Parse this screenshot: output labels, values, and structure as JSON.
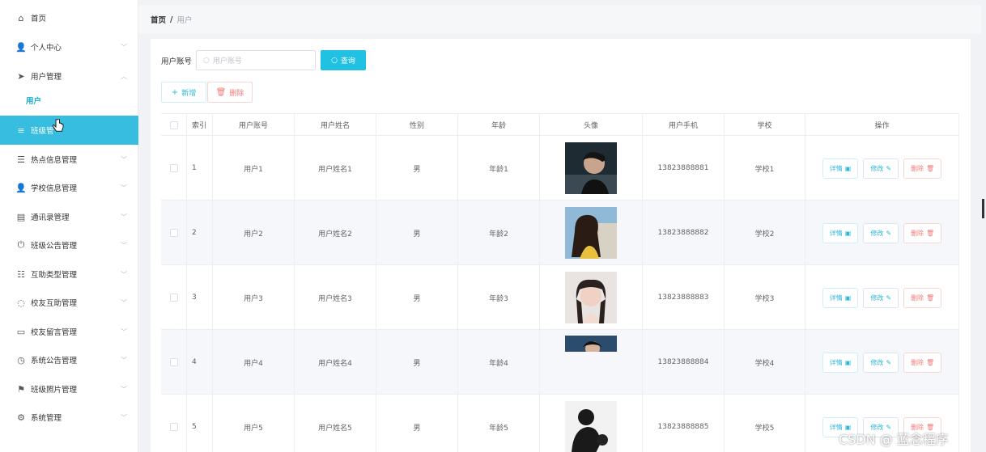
{
  "sidebar": {
    "items": [
      {
        "label": "首页",
        "icon": "home-icon",
        "glyph": "⌂",
        "has_arrow": false
      },
      {
        "label": "个人中心",
        "icon": "person-icon",
        "glyph": "👤",
        "has_arrow": true
      },
      {
        "label": "用户管理",
        "icon": "send-icon",
        "glyph": "➤",
        "has_arrow": true,
        "expanded": true
      },
      {
        "label": "用户",
        "icon": "",
        "glyph": "",
        "has_arrow": false,
        "sub": true
      },
      {
        "label": "班级管",
        "icon": "menu-icon",
        "glyph": "≡",
        "has_arrow": false,
        "active": true
      },
      {
        "label": "热点信息管理",
        "icon": "list-icon",
        "glyph": "☰",
        "has_arrow": true
      },
      {
        "label": "学校信息管理",
        "icon": "user-icon",
        "glyph": "👤",
        "has_arrow": true
      },
      {
        "label": "通讯录管理",
        "icon": "contacts-icon",
        "glyph": "▤",
        "has_arrow": true
      },
      {
        "label": "班级公告管理",
        "icon": "power-icon",
        "glyph": "⏻",
        "has_arrow": true
      },
      {
        "label": "互助类型管理",
        "icon": "category-icon",
        "glyph": "☷",
        "has_arrow": true
      },
      {
        "label": "校友互助管理",
        "icon": "help-icon",
        "glyph": "◌",
        "has_arrow": true
      },
      {
        "label": "校友留言管理",
        "icon": "message-icon",
        "glyph": "▭",
        "has_arrow": true
      },
      {
        "label": "系统公告管理",
        "icon": "compass-icon",
        "glyph": "◷",
        "has_arrow": true
      },
      {
        "label": "班级照片管理",
        "icon": "flag-icon",
        "glyph": "⚑",
        "has_arrow": true
      },
      {
        "label": "系统管理",
        "icon": "settings-icon",
        "glyph": "⚙",
        "has_arrow": true
      }
    ]
  },
  "breadcrumb": {
    "home": "首页",
    "sep": "/",
    "current": "用户"
  },
  "search": {
    "label": "用户账号",
    "placeholder": "用户账号",
    "button": "查询"
  },
  "actions": {
    "add": "新增",
    "delete": "删除"
  },
  "table": {
    "headers": [
      "索引",
      "用户账号",
      "用户姓名",
      "性别",
      "年龄",
      "头像",
      "用户手机",
      "学校",
      "操作"
    ],
    "rows": [
      {
        "index": "1",
        "account": "用户1",
        "name": "用户姓名1",
        "gender": "男",
        "age": "年龄1",
        "phone": "13823888881",
        "school": "学校1"
      },
      {
        "index": "2",
        "account": "用户2",
        "name": "用户姓名2",
        "gender": "男",
        "age": "年龄2",
        "phone": "13823888882",
        "school": "学校2"
      },
      {
        "index": "3",
        "account": "用户3",
        "name": "用户姓名3",
        "gender": "男",
        "age": "年龄3",
        "phone": "13823888883",
        "school": "学校3"
      },
      {
        "index": "4",
        "account": "用户4",
        "name": "用户姓名4",
        "gender": "男",
        "age": "年龄4",
        "phone": "13823888884",
        "school": "学校4"
      },
      {
        "index": "5",
        "account": "用户5",
        "name": "用户姓名5",
        "gender": "男",
        "age": "年龄5",
        "phone": "13823888885",
        "school": "学校5"
      }
    ],
    "ops": {
      "detail": "详情",
      "edit": "修改",
      "remove": "删除"
    }
  },
  "watermark": "CSDN @ 蓝念程序",
  "colors": {
    "accent": "#21c1e3",
    "active_menu": "#36bde0",
    "danger": "#f07b7b"
  }
}
